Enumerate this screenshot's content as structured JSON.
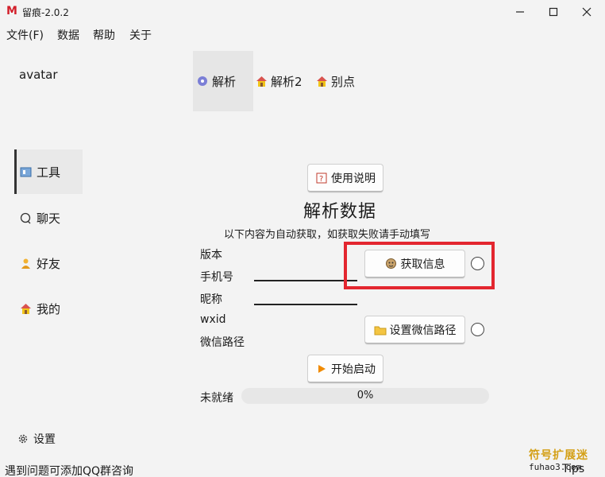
{
  "window": {
    "logo_letter": "M",
    "title": "留痕-2.0.2",
    "minimize": "—",
    "maximize": "☐",
    "close": "✕"
  },
  "menu": [
    "文件(F)",
    "数据",
    "帮助",
    "关于"
  ],
  "sidebar": {
    "avatar": "avatar",
    "items": [
      {
        "label": "工具",
        "icon": "toolbox-icon"
      },
      {
        "label": "聊天",
        "icon": "chat-icon"
      },
      {
        "label": "好友",
        "icon": "person-icon"
      },
      {
        "label": "我的",
        "icon": "house-icon"
      }
    ],
    "settings": "设置"
  },
  "tabs": [
    {
      "label": "解析",
      "icon": "disc-icon"
    },
    {
      "label": "解析2",
      "icon": "house-icon"
    },
    {
      "label": "别点",
      "icon": "house-icon"
    }
  ],
  "main": {
    "help_button": "使用说明",
    "heading": "解析数据",
    "subtext": "以下内容为自动获取，如获取失败请手动填写",
    "fields": [
      "版本",
      "手机号",
      "昵称",
      "wxid",
      "微信路径"
    ],
    "get_info_button": "获取信息",
    "set_path_button": "设置微信路径",
    "start_button": "开始启动",
    "status": "未就绪",
    "progress_text": "0%",
    "progress": 0
  },
  "footer": {
    "help_text": "遇到问题可添加QQ群咨询",
    "tips": "Tips"
  },
  "watermark": {
    "cn": "符号扩展迷",
    "en": "fuhao3.com"
  },
  "colors": {
    "highlight": "#e3262f",
    "window_bg": "#f3f3f3",
    "logo": "#d21f2a"
  }
}
